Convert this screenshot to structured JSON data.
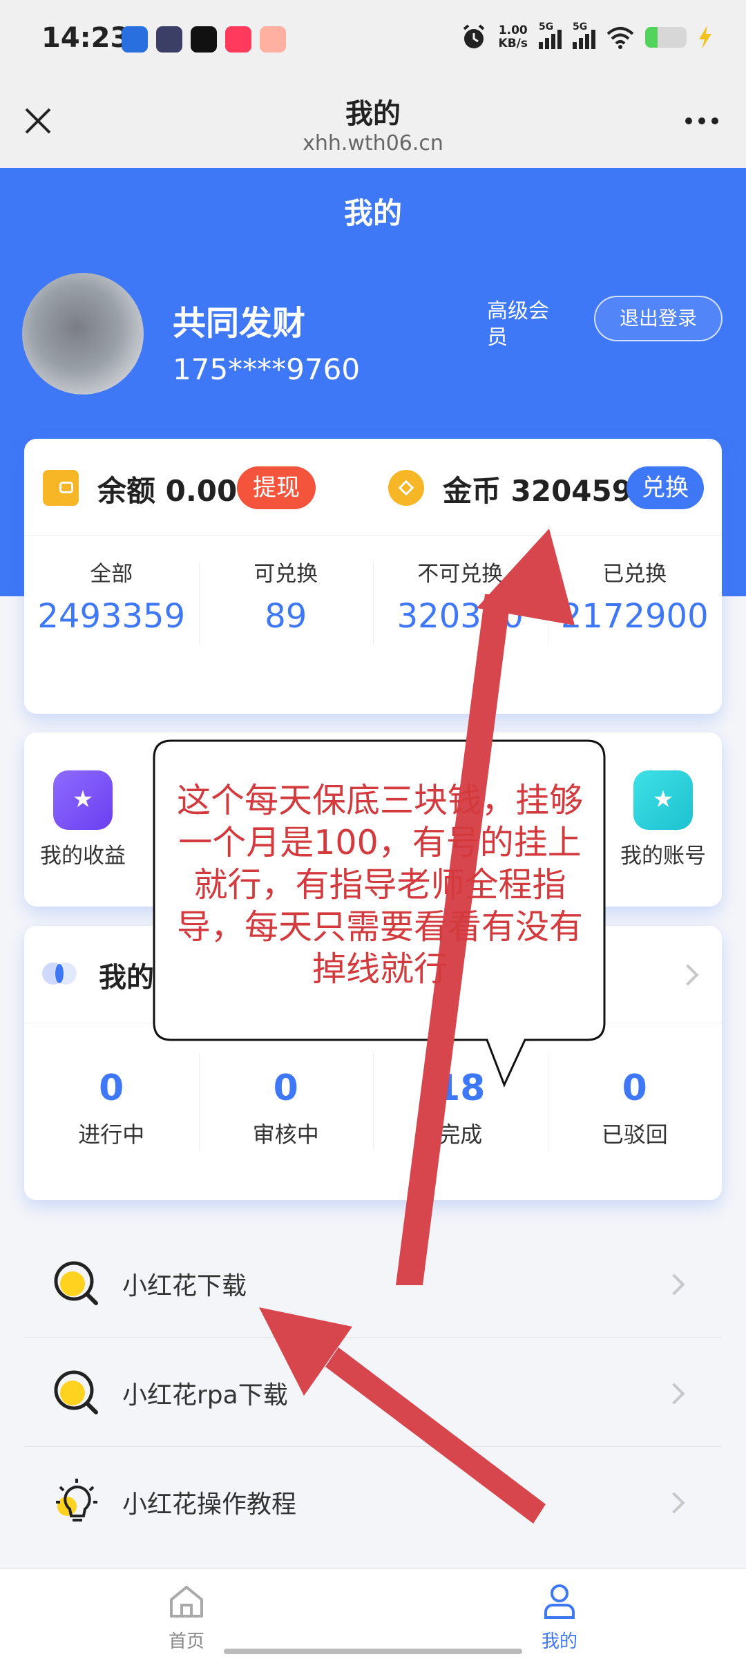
{
  "status_bar": {
    "time": "14:23",
    "net_speed_value": "1.00",
    "net_speed_unit": "KB/s",
    "signal_1": "5G",
    "signal_2": "5G",
    "battery_level": 0.3,
    "icons": [
      "app-icon-1",
      "app-icon-2",
      "tiktok-icon",
      "app-icon-4",
      "app-icon-5",
      "alarm-icon",
      "signal-icon",
      "wifi-icon",
      "battery-icon",
      "charging-icon"
    ]
  },
  "nav": {
    "title": "我的",
    "url": "xhh.wth06.cn"
  },
  "header": {
    "title": "我的",
    "username": "共同发财",
    "phone": "175****9760",
    "member_level": "高级会员",
    "logout_label": "退出登录"
  },
  "balance": {
    "balance_text": "余额 0.00",
    "withdraw_label": "提现",
    "coins_text": "金币 320459",
    "exchange_label": "兑换",
    "stats": [
      {
        "label": "全部",
        "value": "2493359"
      },
      {
        "label": "可兑换",
        "value": "89"
      },
      {
        "label": "不可兑换",
        "value": "320370"
      },
      {
        "label": "已兑换",
        "value": "2172900"
      }
    ]
  },
  "menu": {
    "income_label": "我的收益",
    "account_label": "我的账号"
  },
  "tasks": {
    "title_visible": "我的",
    "stats": [
      {
        "value": "0",
        "label": "进行中"
      },
      {
        "value": "0",
        "label": "审核中"
      },
      {
        "value": "18",
        "label": "完成"
      },
      {
        "value": "0",
        "label": "已驳回"
      }
    ]
  },
  "list": [
    {
      "label": "小红花下载",
      "icon": "search-icon"
    },
    {
      "label": "小红花rpa下载",
      "icon": "search-icon"
    },
    {
      "label": "小红花操作教程",
      "icon": "lightbulb-icon"
    }
  ],
  "tabbar": {
    "home_label": "首页",
    "mine_label": "我的"
  },
  "annotation": {
    "text": "这个每天保底三块钱，挂够一个月是100，有号的挂上就行，有指导老师全程指导，每天只需要看看有没有掉线就行"
  },
  "colors": {
    "primary": "#3f78f6",
    "danger": "#f4533c",
    "gold": "#f6b626",
    "annotation_red": "#d33a3e"
  }
}
